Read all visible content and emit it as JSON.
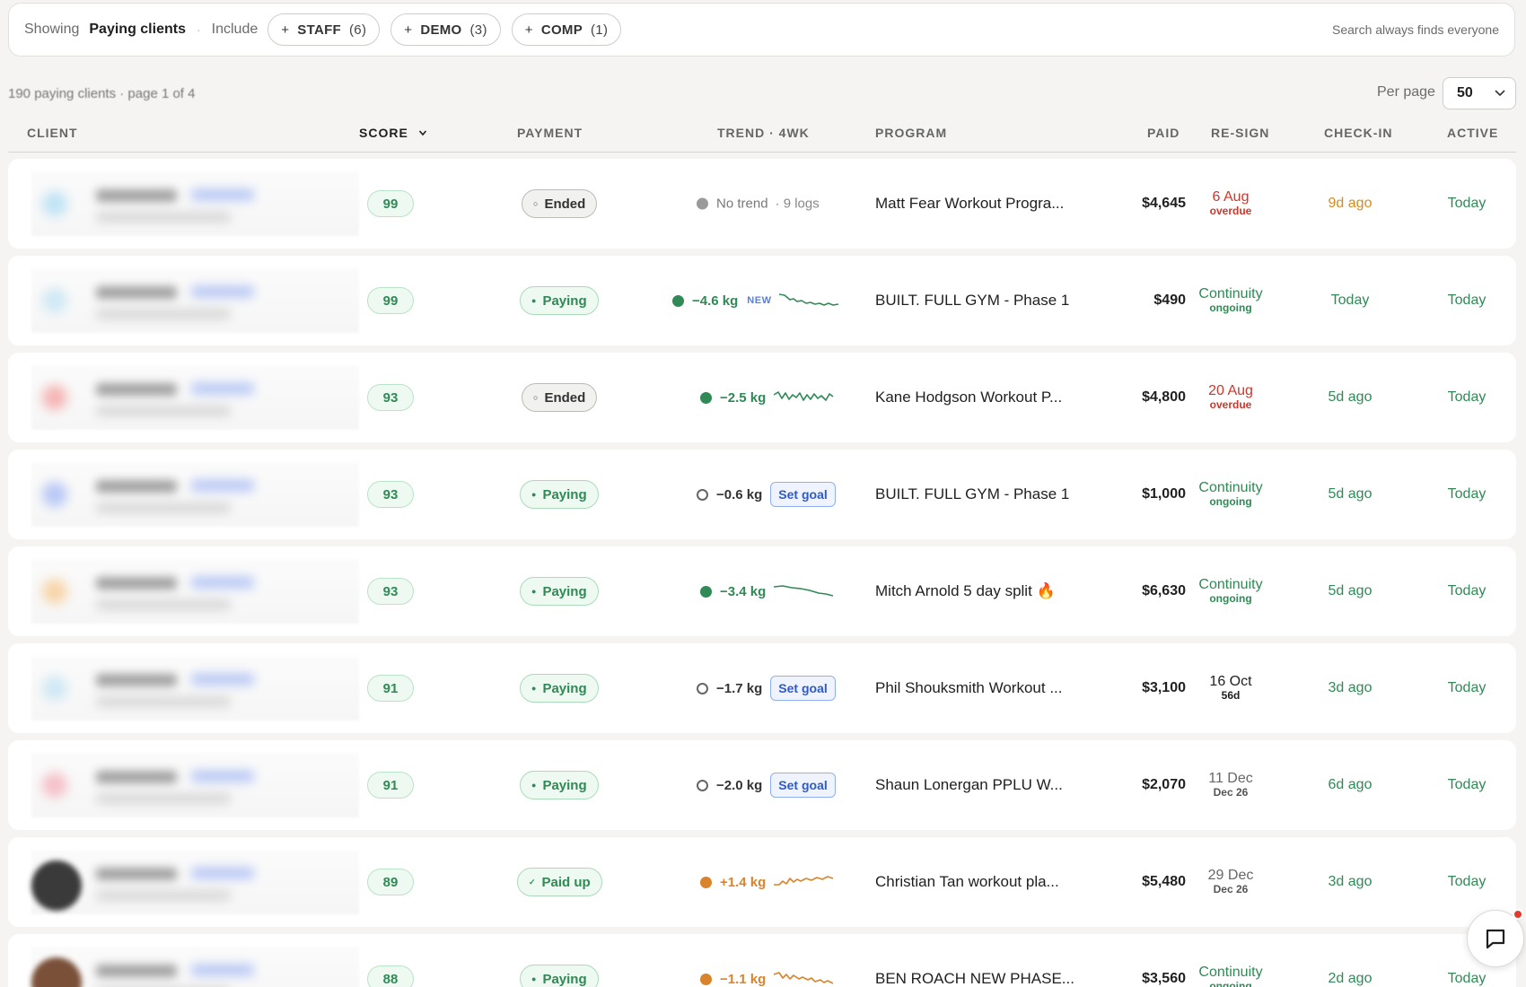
{
  "filter_bar": {
    "showing_label": "Showing",
    "showing_value": "Paying clients",
    "separator": "·",
    "include_label": "Include",
    "chips": [
      {
        "plus": "+",
        "label": "STAFF",
        "count": "(6)"
      },
      {
        "plus": "+",
        "label": "DEMO",
        "count": "(3)"
      },
      {
        "plus": "+",
        "label": "COMP",
        "count": "(1)"
      }
    ],
    "note": "Search always finds everyone"
  },
  "page_info": "190 paying clients · page 1 of 4",
  "per_page": {
    "label": "Per page",
    "value": "50"
  },
  "columns": {
    "client": "CLIENT",
    "score": "SCORE",
    "payment": "PAYMENT",
    "trend": "TREND · 4WK",
    "program": "PROGRAM",
    "paid": "PAID",
    "resign": "RE-SIGN",
    "checkin": "CHECK-IN",
    "active": "ACTIVE"
  },
  "rows": [
    {
      "score": "99",
      "payment": {
        "status": "Ended",
        "kind": "ended",
        "mark": "○"
      },
      "trend": {
        "kind": "none",
        "text": "No trend",
        "logs": "· 9 logs"
      },
      "program": "Matt Fear Workout Progra...",
      "paid": "$4,645",
      "resign": {
        "main": "6 Aug",
        "sub": "overdue",
        "color": "#d0352b"
      },
      "checkin": {
        "text": "9d ago",
        "color": "#d98a1e"
      },
      "active": "Today",
      "avatar_color": "#bfe3f5"
    },
    {
      "score": "99",
      "payment": {
        "status": "Paying",
        "kind": "paying",
        "mark": "●"
      },
      "trend": {
        "kind": "value",
        "marker": "dot",
        "dot_color": "#2f8a55",
        "value": "−4.6 kg",
        "value_color": "#2f8a55",
        "badge": "NEW",
        "spark": "down",
        "spark_color": "#2f8a55"
      },
      "program": "BUILT. FULL GYM - Phase 1",
      "paid": "$490",
      "resign": {
        "main": "Continuity",
        "sub": "ongoing",
        "color": "#2f8a55"
      },
      "checkin": {
        "text": "Today",
        "color": "#2f8a55"
      },
      "active": "Today",
      "avatar_color": "#cfe8f5"
    },
    {
      "score": "93",
      "payment": {
        "status": "Ended",
        "kind": "ended",
        "mark": "○"
      },
      "trend": {
        "kind": "value",
        "marker": "dot",
        "dot_color": "#2f8a55",
        "value": "−2.5 kg",
        "value_color": "#2f8a55",
        "spark": "jagged",
        "spark_color": "#2f8a55"
      },
      "program": "Kane Hodgson Workout P...",
      "paid": "$4,800",
      "resign": {
        "main": "20 Aug",
        "sub": "overdue",
        "color": "#d0352b"
      },
      "checkin": {
        "text": "5d ago",
        "color": "#2f8a55"
      },
      "active": "Today",
      "avatar_color": "#f5b5b5"
    },
    {
      "score": "93",
      "payment": {
        "status": "Paying",
        "kind": "paying",
        "mark": "●"
      },
      "trend": {
        "kind": "value",
        "marker": "ring",
        "value": "−0.6 kg",
        "value_color": "#333",
        "goal": "Set goal"
      },
      "program": "BUILT. FULL GYM - Phase 1",
      "paid": "$1,000",
      "resign": {
        "main": "Continuity",
        "sub": "ongoing",
        "color": "#2f8a55"
      },
      "checkin": {
        "text": "5d ago",
        "color": "#2f8a55"
      },
      "active": "Today",
      "avatar_color": "#b8c8f5"
    },
    {
      "score": "93",
      "payment": {
        "status": "Paying",
        "kind": "paying",
        "mark": "●"
      },
      "trend": {
        "kind": "value",
        "marker": "dot",
        "dot_color": "#2f8a55",
        "value": "−3.4 kg",
        "value_color": "#2f8a55",
        "spark": "smooth-down",
        "spark_color": "#2f8a55"
      },
      "program": "Mitch Arnold 5 day split 🔥",
      "paid": "$6,630",
      "resign": {
        "main": "Continuity",
        "sub": "ongoing",
        "color": "#2f8a55"
      },
      "checkin": {
        "text": "5d ago",
        "color": "#2f8a55"
      },
      "active": "Today",
      "avatar_color": "#f7d5a8"
    },
    {
      "score": "91",
      "payment": {
        "status": "Paying",
        "kind": "paying",
        "mark": "●"
      },
      "trend": {
        "kind": "value",
        "marker": "ring",
        "value": "−1.7 kg",
        "value_color": "#333",
        "goal": "Set goal"
      },
      "program": "Phil Shouksmith Workout ...",
      "paid": "$3,100",
      "resign": {
        "main": "16 Oct",
        "sub": "56d",
        "color": "#1f1f1f"
      },
      "checkin": {
        "text": "3d ago",
        "color": "#2f8a55"
      },
      "active": "Today",
      "avatar_color": "#cfe8f5"
    },
    {
      "score": "91",
      "payment": {
        "status": "Paying",
        "kind": "paying",
        "mark": "●"
      },
      "trend": {
        "kind": "value",
        "marker": "ring",
        "value": "−2.0 kg",
        "value_color": "#333",
        "goal": "Set goal"
      },
      "program": "Shaun Lonergan PPLU W...",
      "paid": "$2,070",
      "resign": {
        "main": "11 Dec",
        "sub": "Dec 26",
        "color": "#666"
      },
      "checkin": {
        "text": "6d ago",
        "color": "#2f8a55"
      },
      "active": "Today",
      "avatar_color": "#f5c0c8"
    },
    {
      "score": "89",
      "payment": {
        "status": "Paid up",
        "kind": "paidup",
        "mark": "✓"
      },
      "trend": {
        "kind": "value",
        "marker": "dot",
        "dot_color": "#d9832b",
        "value": "+1.4 kg",
        "value_color": "#d9832b",
        "spark": "up",
        "spark_color": "#d9832b"
      },
      "program": "Christian Tan workout pla...",
      "paid": "$5,480",
      "resign": {
        "main": "29 Dec",
        "sub": "Dec 26",
        "color": "#666"
      },
      "checkin": {
        "text": "3d ago",
        "color": "#2f8a55"
      },
      "active": "Today",
      "avatar_color": "#3a3a3a",
      "avatar_photo": true
    },
    {
      "score": "88",
      "payment": {
        "status": "Paying",
        "kind": "paying",
        "mark": "●"
      },
      "trend": {
        "kind": "value",
        "marker": "dot",
        "dot_color": "#d9832b",
        "value": "−1.1 kg",
        "value_color": "#d9832b",
        "spark": "wave",
        "spark_color": "#d9832b"
      },
      "program": "BEN ROACH NEW PHASE...",
      "paid": "$3,560",
      "resign": {
        "main": "Continuity",
        "sub": "ongoing",
        "color": "#2f8a55"
      },
      "checkin": {
        "text": "2d ago",
        "color": "#2f8a55"
      },
      "active": "Today",
      "avatar_color": "#7a5038",
      "avatar_photo": true
    }
  ]
}
